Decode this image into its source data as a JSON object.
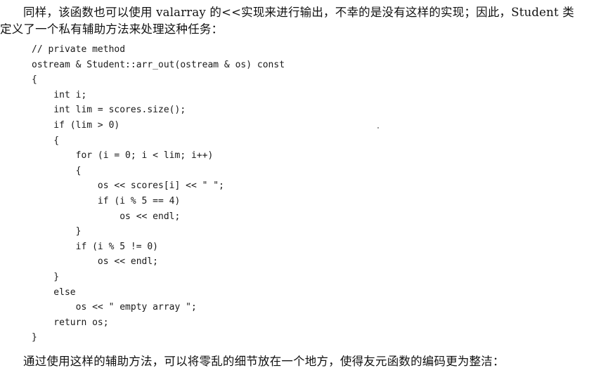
{
  "intro": {
    "line1": "同样，该函数也可以使用 valarray 的<<实现来进行输出，不幸的是没有这样的实现；因此，Student 类",
    "line2": "定义了一个私有辅助方法来处理这种任务："
  },
  "code": {
    "lines": [
      "// private method",
      "ostream & Student::arr_out(ostream & os) const",
      "{",
      "    int i;",
      "    int lim = scores.size();",
      "    if (lim > 0)",
      "    {",
      "        for (i = 0; i < lim; i++)",
      "        {",
      "            os << scores[i] << \" \";",
      "            if (i % 5 == 4)",
      "                os << endl;",
      "        }",
      "        if (i % 5 != 0)",
      "            os << endl;",
      "    }",
      "    else",
      "        os << \" empty array \";",
      "    return os;",
      "}"
    ]
  },
  "outro": {
    "text": "通过使用这样的辅助方法，可以将零乱的细节放在一个地方，使得友元函数的编码更为整洁："
  }
}
